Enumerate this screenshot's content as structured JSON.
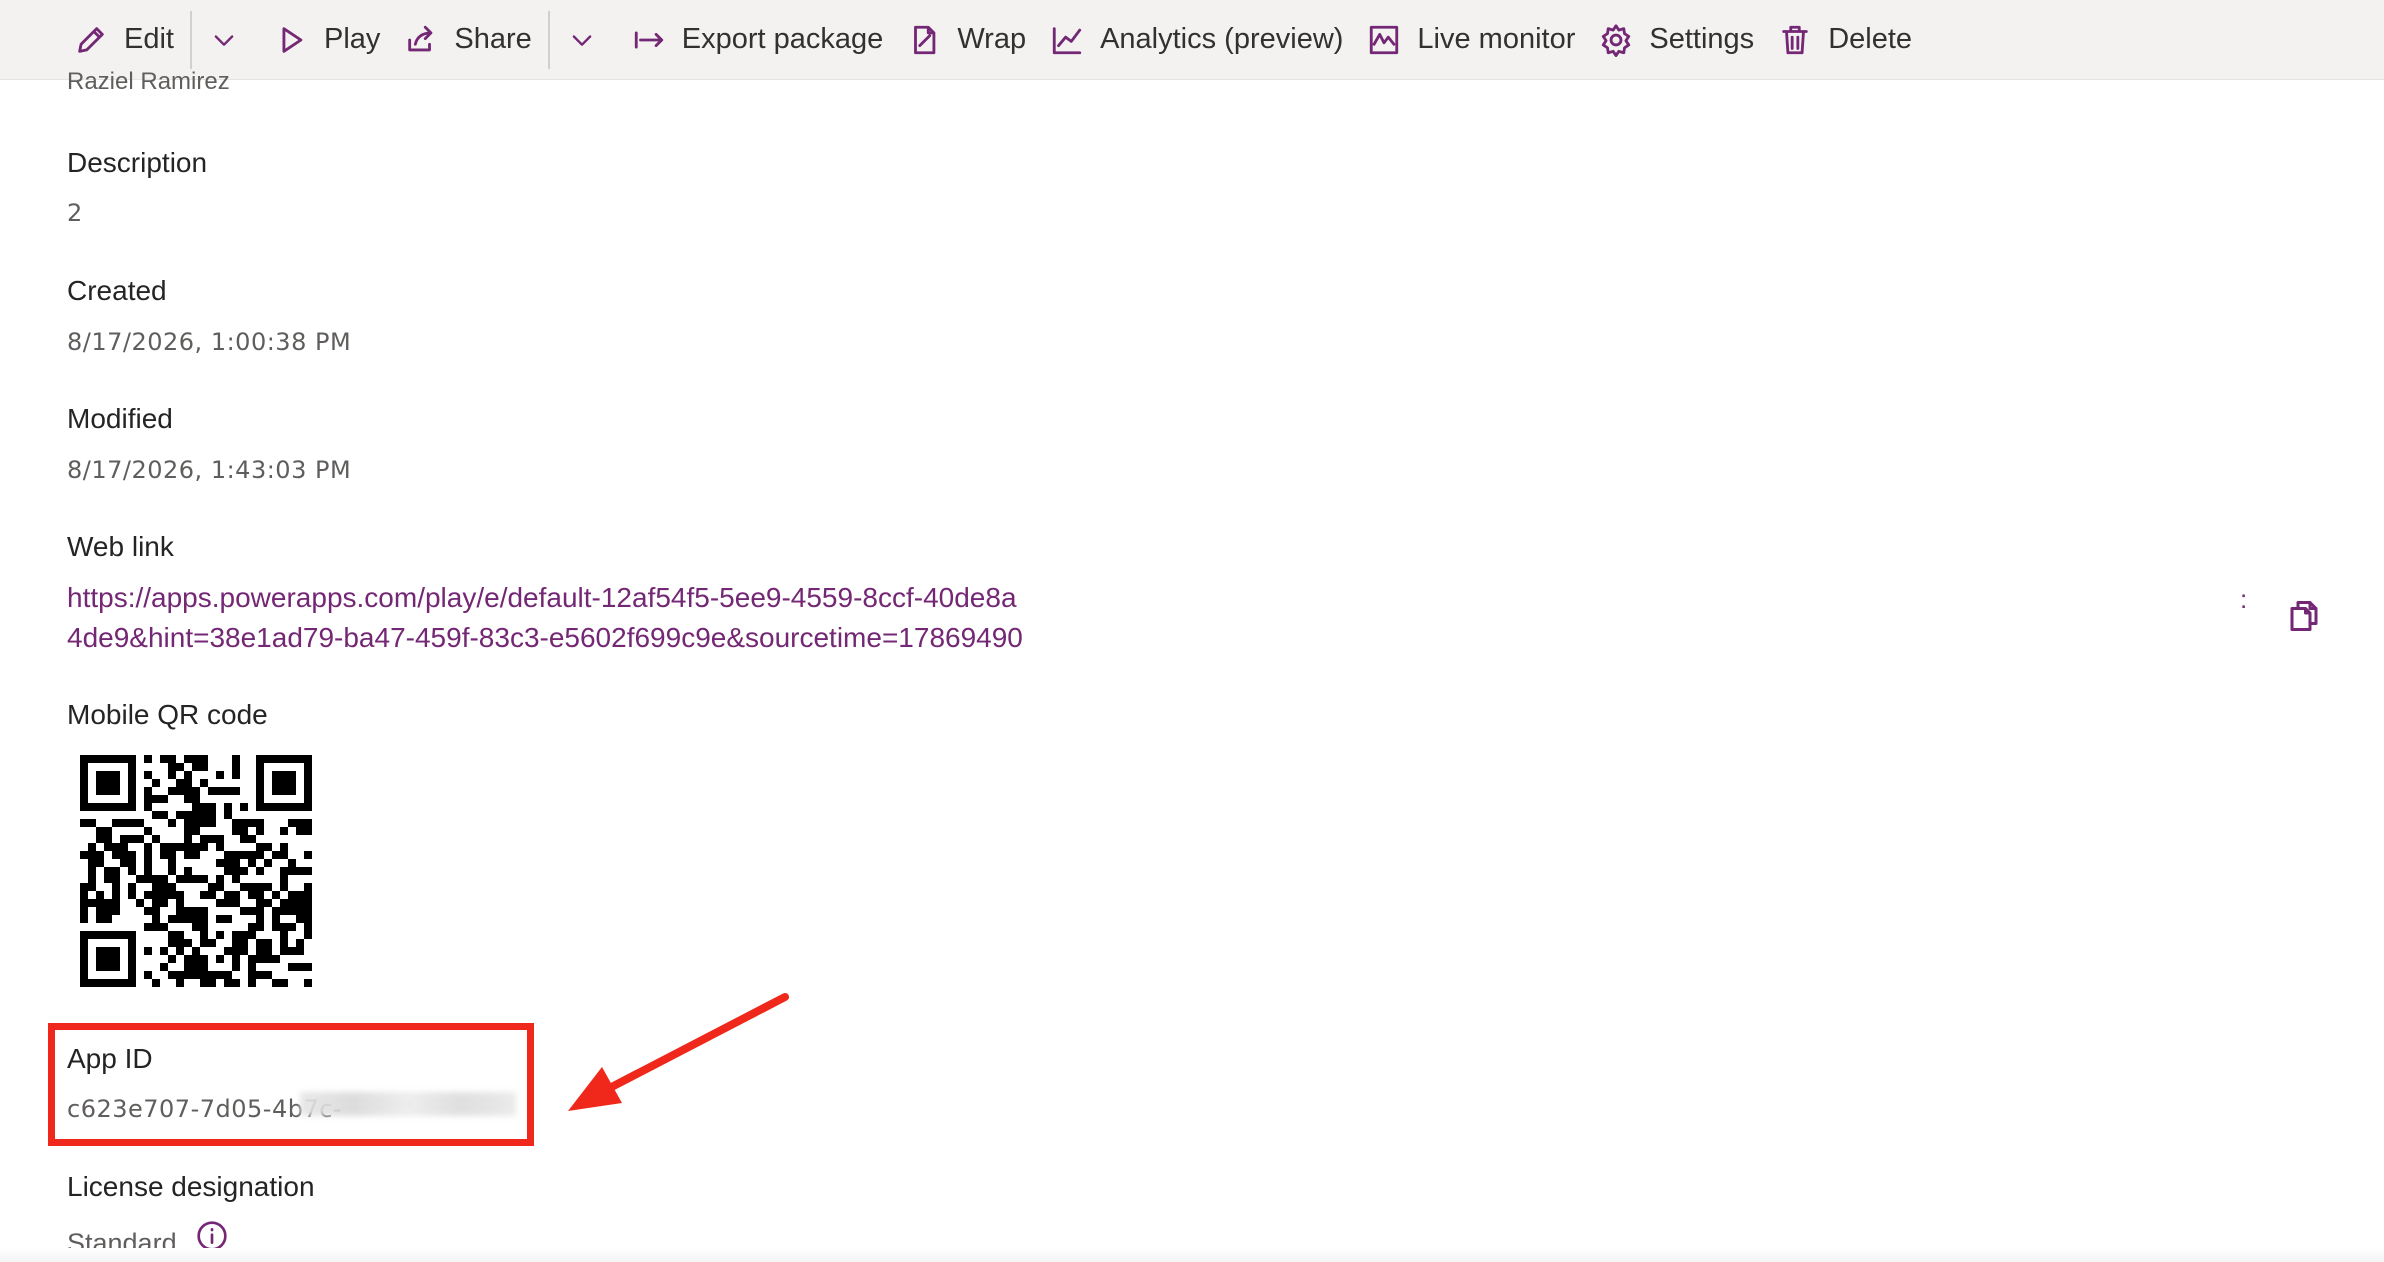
{
  "toolbar": {
    "edit": "Edit",
    "play": "Play",
    "share": "Share",
    "export": "Export package",
    "wrap": "Wrap",
    "analytics": "Analytics (preview)",
    "live_monitor": "Live monitor",
    "settings": "Settings",
    "delete": "Delete"
  },
  "details": {
    "owner": "Raziel Ramirez",
    "description_label": "Description",
    "description_value": "2",
    "created_label": "Created",
    "created_value": "8/17/2026, 1:00:38 PM",
    "modified_label": "Modified",
    "modified_value": "8/17/2026, 1:43:03 PM",
    "weblink_label": "Web link",
    "weblink_line1": "https://apps.powerapps.com/play/e/default-12af54f5-5ee9-4559-8ccf-40de8a",
    "weblink_line2": "4de9&hint=38e1ad79-ba47-459f-83c3-e5602f699c9e&sourcetime=17869490",
    "qr_label": "Mobile QR code",
    "appid_label": "App ID",
    "appid_value": "c623e707-7d05-4b7c-",
    "license_label": "License designation",
    "license_value": "Standard"
  },
  "icons": {
    "toolbar": [
      "edit-icon",
      "chevron-down-icon",
      "play-icon",
      "share-icon",
      "chevron-down-icon",
      "export-icon",
      "wrap-icon",
      "analytics-icon",
      "live-monitor-icon",
      "settings-icon",
      "delete-icon"
    ],
    "copy": "copy-icon",
    "info": "info-icon"
  },
  "colors": {
    "accent": "#742774",
    "annotation": "#f0281c",
    "toolbar_bg": "#f3f2f1"
  }
}
